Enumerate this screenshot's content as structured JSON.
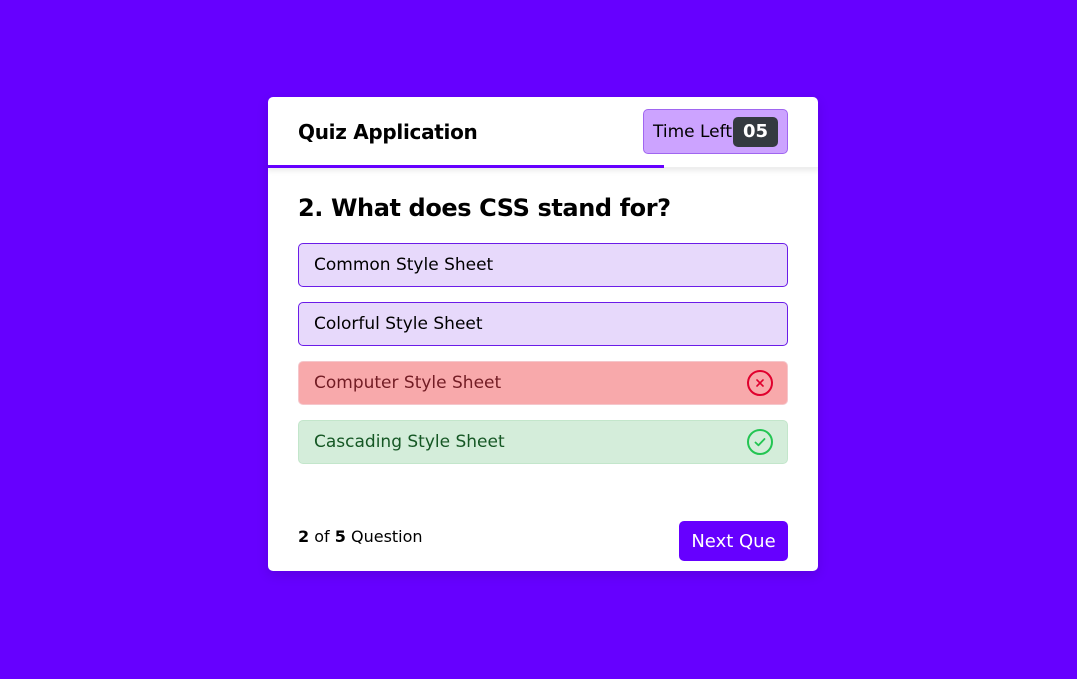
{
  "header": {
    "title": "Quiz Application",
    "timer_label": "Time Left",
    "timer_seconds": "05",
    "time_progress": 0.72
  },
  "question": {
    "text": "2. What does CSS stand for?"
  },
  "options": [
    {
      "label": "Common Style Sheet",
      "state": "neutral",
      "icon": ""
    },
    {
      "label": "Colorful Style Sheet",
      "state": "neutral",
      "icon": ""
    },
    {
      "label": "Computer Style Sheet",
      "state": "incorrect",
      "icon": "cross-circle-icon"
    },
    {
      "label": "Cascading Style Sheet",
      "state": "correct",
      "icon": "check-circle-icon"
    }
  ],
  "footer": {
    "current": "2",
    "of": "of",
    "total": "5",
    "suffix": "Question",
    "next_label": "Next Que"
  },
  "colors": {
    "background": "#6600ff",
    "accent": "#6600ff",
    "incorrect_icon": "#e0002d",
    "correct_icon": "#23c552"
  }
}
